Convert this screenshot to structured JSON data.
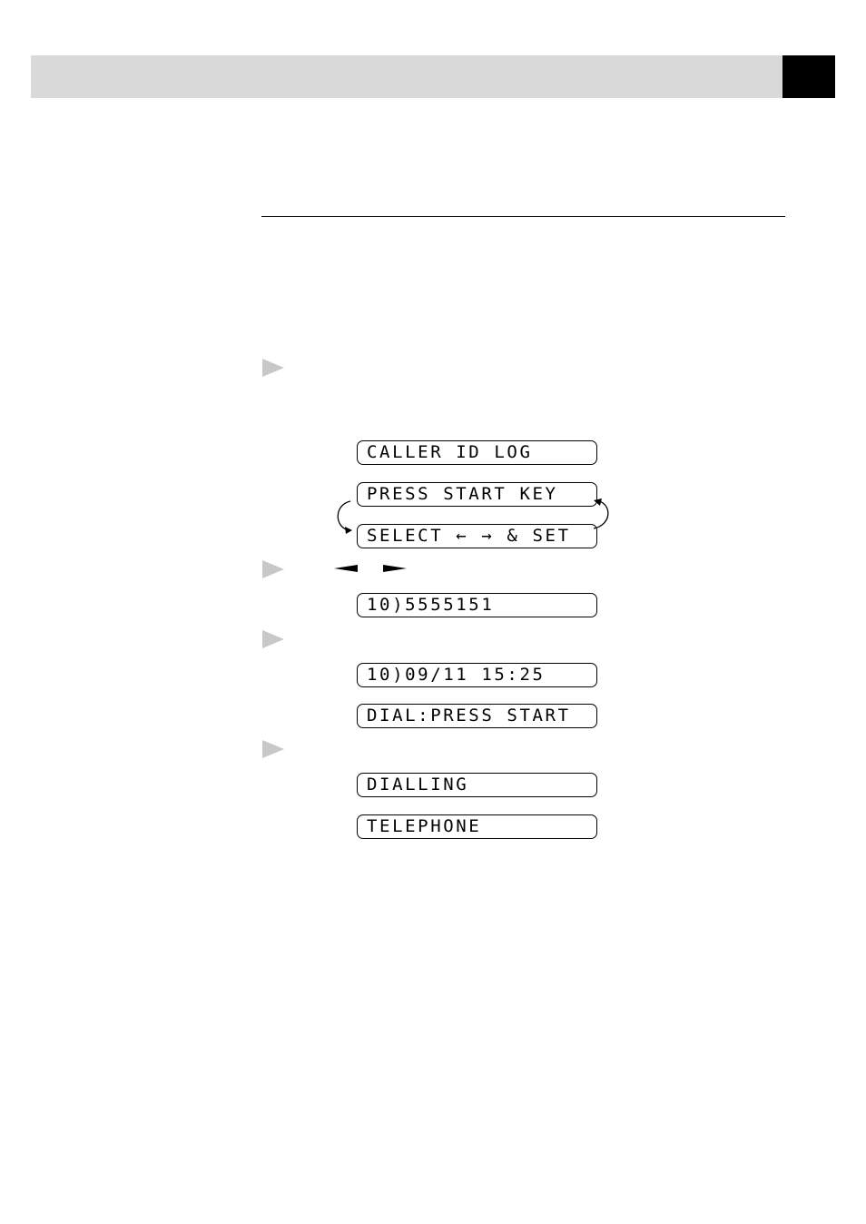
{
  "header": {
    "band_color": "#d9d9d9",
    "tab_color": "#000000"
  },
  "steps": [
    {
      "marker": "step-arrow",
      "displays": [
        "CALLER ID LOG",
        "PRESS START KEY",
        "SELECT ← → & SET"
      ],
      "loop_between": [
        "PRESS START KEY",
        "SELECT ← → & SET"
      ]
    },
    {
      "marker": "step-arrow",
      "keys": [
        "left-arrow-key",
        "right-arrow-key"
      ],
      "displays": [
        "10)5555151"
      ]
    },
    {
      "marker": "step-arrow",
      "displays": [
        "10)09/11 15:25",
        "DIAL:PRESS START"
      ]
    },
    {
      "marker": "step-arrow",
      "displays": [
        "DIALLING",
        "TELEPHONE"
      ]
    }
  ],
  "colors": {
    "step_marker": "#c8c8c8",
    "lcd_border": "#000000"
  }
}
